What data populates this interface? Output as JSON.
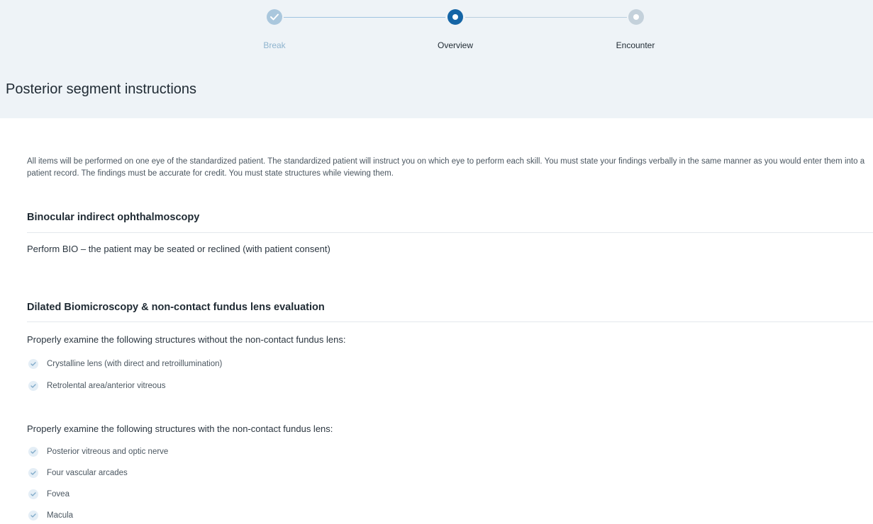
{
  "stepper": {
    "steps": [
      {
        "label": "Break",
        "state": "completed"
      },
      {
        "label": "Overview",
        "state": "active"
      },
      {
        "label": "Encounter",
        "state": "upcoming"
      }
    ]
  },
  "page": {
    "title": "Posterior segment instructions"
  },
  "intro": "All items will be performed on one eye of the standardized patient. The standardized patient will instruct you on which eye to perform each skill. You must state your findings verbally in the same manner as you would enter them into a patient record. The findings must be accurate for credit. You must state structures while viewing them.",
  "sections": [
    {
      "title": "Binocular indirect ophthalmoscopy",
      "text": "Perform BIO – the patient may be seated or reclined (with patient consent)"
    },
    {
      "title": "Dilated Biomicroscopy & non-contact fundus lens evaluation",
      "groups": [
        {
          "heading": "Properly examine the following structures without the non-contact fundus lens:",
          "items": [
            "Crystalline lens (with direct and retroillumination)",
            "Retrolental area/anterior vitreous"
          ]
        },
        {
          "heading": "Properly examine the following structures with the non-contact fundus lens:",
          "items": [
            "Posterior vitreous and optic nerve",
            "Four vascular arcades",
            "Fovea",
            "Macula"
          ]
        }
      ]
    }
  ],
  "colors": {
    "header_bg": "#eef3f7",
    "active_step": "#1565a6",
    "completed_step": "#aac7dd",
    "upcoming_step": "#c4d1db",
    "check_icon_bg": "#e4eef6"
  },
  "icons": {
    "completed_step": "checkmark-icon",
    "list_item": "check-circle-icon"
  }
}
